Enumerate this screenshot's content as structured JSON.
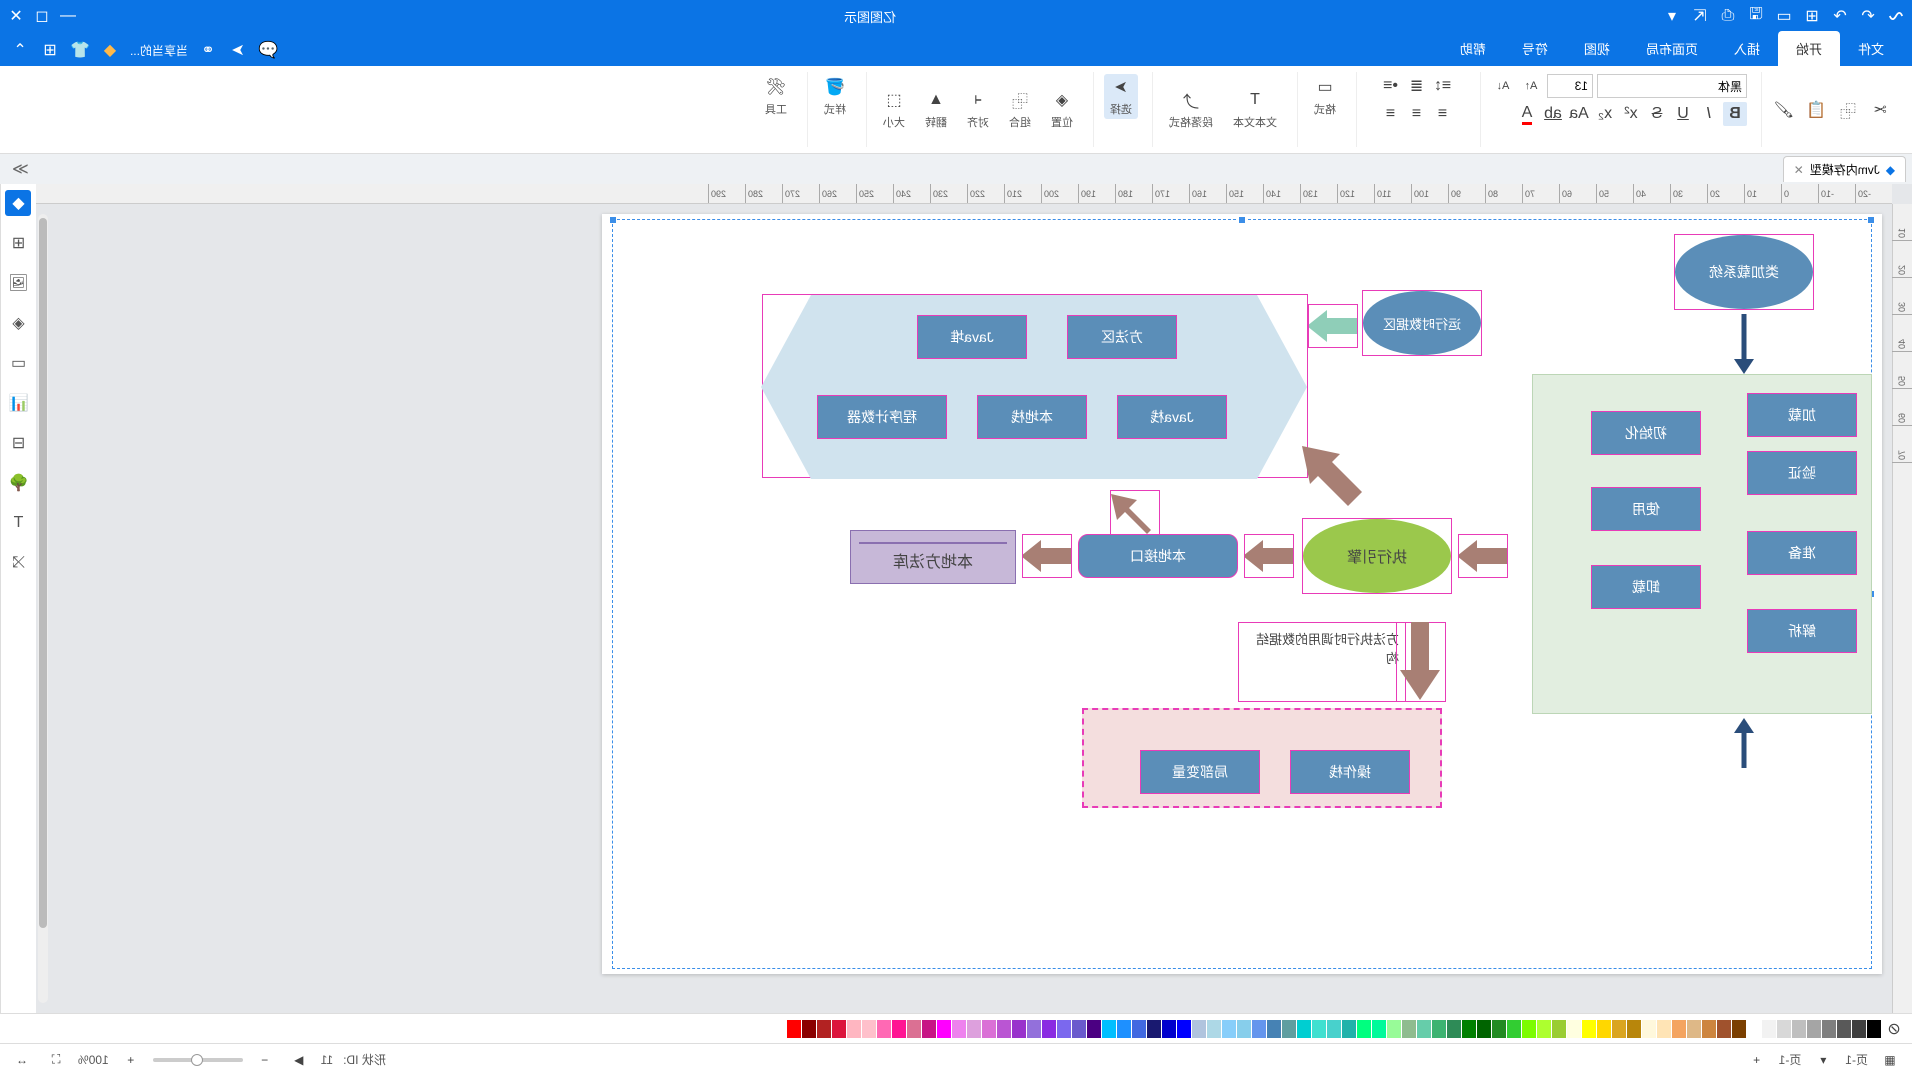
{
  "title": "亿图图示",
  "menu_tabs": [
    "文件",
    "开始",
    "插入",
    "页面布局",
    "视图",
    "符号",
    "帮助"
  ],
  "active_menu_tab": 1,
  "quick_labels": {
    "template": "模板",
    "more": "当享当的..."
  },
  "ribbon": {
    "font_name": "黑体",
    "font_size": "13",
    "groups": {
      "format": "格式",
      "font": "文本文本",
      "paragraph": "段落格式",
      "select": "选择",
      "position": "位置",
      "combine": "组合",
      "align": "对齐",
      "flip": "翻转",
      "size": "大小",
      "style": "样式",
      "tools": "工具"
    }
  },
  "doc_tab": {
    "name": "Jvm内存模型",
    "icon": "file-icon"
  },
  "ruler_h": [
    "-20",
    "-10",
    "0",
    "10",
    "20",
    "30",
    "40",
    "50",
    "60",
    "70",
    "80",
    "90",
    "100",
    "110",
    "120",
    "130",
    "140",
    "150",
    "160",
    "170",
    "180",
    "190",
    "200",
    "210",
    "220",
    "230",
    "240",
    "250",
    "260",
    "270",
    "280",
    "290"
  ],
  "ruler_v": [
    "10",
    "20",
    "30",
    "40",
    "50",
    "60",
    "70"
  ],
  "diagram": {
    "loader": "类加载系统",
    "green_box_left": [
      "加载",
      "验证",
      "准备",
      "解析"
    ],
    "green_box_right": [
      "初始化",
      "使用",
      "卸载"
    ],
    "runtime_data": "运行时数据区",
    "engine": "执行引擎",
    "native_iface": "本地接口",
    "native_lib": "本地方法库",
    "hex_items": [
      "方法区",
      "Java堆",
      "Java栈",
      "本地栈",
      "程序计数器"
    ],
    "method_note": "方法执行时调用的数据结构",
    "bottom_boxes": [
      "操作栈",
      "局部变量"
    ]
  },
  "status": {
    "page_label_left": "页-1",
    "page_label_right": "页-1",
    "shape_id_label": "形状 ID:",
    "shape_id": "11",
    "zoom": "100%"
  },
  "palette_colors": [
    "#000000",
    "#3f3f3f",
    "#595959",
    "#7f7f7f",
    "#a5a5a5",
    "#bfbfbf",
    "#d8d8d8",
    "#f2f2f2",
    "#ffffff",
    "#7b3f00",
    "#a0522d",
    "#cd853f",
    "#deb887",
    "#f4a460",
    "#ffe4b5",
    "#fff8dc",
    "#b8860b",
    "#daa520",
    "#ffd700",
    "#ffff00",
    "#ffffe0",
    "#9acd32",
    "#adff2f",
    "#7cfc00",
    "#32cd32",
    "#228b22",
    "#006400",
    "#008000",
    "#2e8b57",
    "#3cb371",
    "#66cdaa",
    "#8fbc8f",
    "#98fb98",
    "#00fa9a",
    "#00ff7f",
    "#20b2aa",
    "#48d1cc",
    "#40e0d0",
    "#00ced1",
    "#5f9ea0",
    "#4682b4",
    "#6495ed",
    "#87ceeb",
    "#87cefa",
    "#add8e6",
    "#b0c4de",
    "#0000ff",
    "#0000cd",
    "#191970",
    "#4169e1",
    "#1e90ff",
    "#00bfff",
    "#4b0082",
    "#6a5acd",
    "#7b68ee",
    "#8a2be2",
    "#9370db",
    "#9932cc",
    "#ba55d3",
    "#da70d6",
    "#dda0dd",
    "#ee82ee",
    "#ff00ff",
    "#c71585",
    "#db7093",
    "#ff1493",
    "#ff69b4",
    "#ffc0cb",
    "#ffb6c1",
    "#dc143c",
    "#b22222",
    "#8b0000",
    "#ff0000"
  ]
}
